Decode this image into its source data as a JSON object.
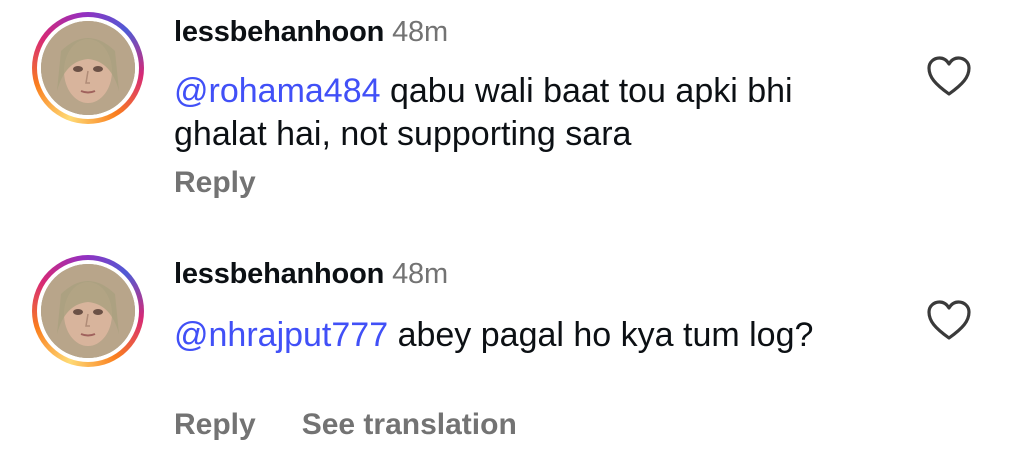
{
  "comments": [
    {
      "username": "lessbehanhoon",
      "time": "48m",
      "mention": "@rohama484",
      "text": " qabu wali baat tou apki bhi ghalat hai, not supporting sara",
      "actions": {
        "reply": "Reply"
      }
    },
    {
      "username": "lessbehanhoon",
      "time": "48m",
      "mention": "@nhrajput777",
      "text": " abey pagal ho kya tum log?",
      "actions": {
        "reply": "Reply",
        "translate": "See translation"
      }
    }
  ],
  "icons": {
    "like": "heart-outline-icon",
    "avatar": "profile-photo"
  },
  "colors": {
    "mention": "#4150f7",
    "muted": "#737373",
    "text": "#0c1014"
  }
}
